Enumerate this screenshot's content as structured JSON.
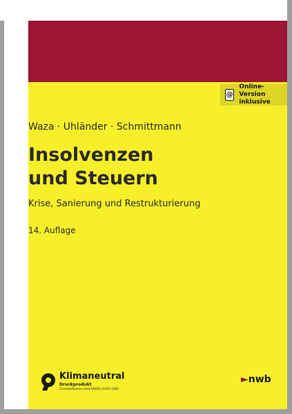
{
  "book": {
    "authors": "Waza · Uhländer · Schmittmann",
    "title_line1": "Insolvenzen",
    "title_line2": "und Steuern",
    "subtitle": "Krise, Sanierung und Restrukturierung",
    "edition": "14. Auflage"
  },
  "online_badge": {
    "icon": "at-icon",
    "symbol": "@",
    "line1": "Online-Version",
    "line2": "inklusive"
  },
  "climate_label": {
    "icon": "climate-pin-icon",
    "name": "Klimaneutral",
    "sub": "Druckprodukt",
    "url": "ClimatePartner.com/16605-2105-1001"
  },
  "publisher": {
    "name": "nwb"
  },
  "colors": {
    "cover_yellow": "#f7ef2a",
    "band_red": "#9c1535",
    "text": "#2a2a2a",
    "frame_gray": "#9e9e9e"
  }
}
